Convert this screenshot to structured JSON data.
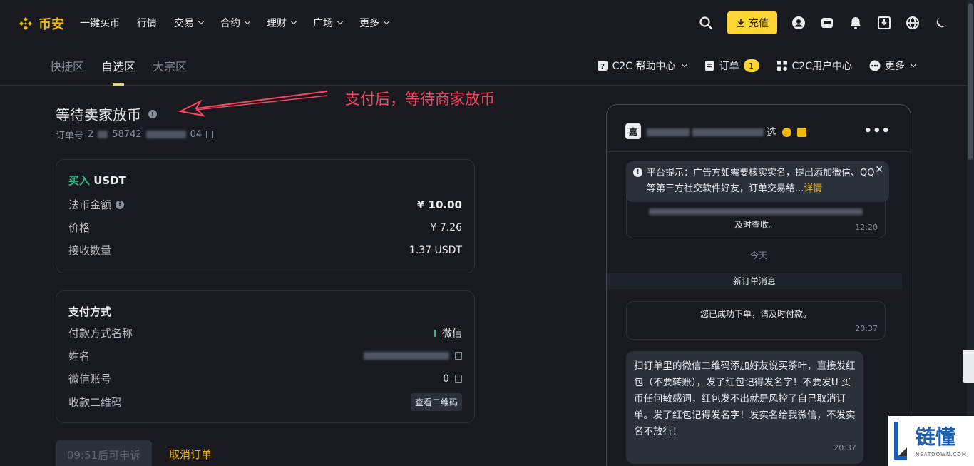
{
  "brand": {
    "name": "币安",
    "color": "#f0b90b"
  },
  "nav": {
    "items": [
      {
        "label": "一键买币",
        "dropdown": false
      },
      {
        "label": "行情",
        "dropdown": false
      },
      {
        "label": "交易",
        "dropdown": true
      },
      {
        "label": "合约",
        "dropdown": true
      },
      {
        "label": "理财",
        "dropdown": true
      },
      {
        "label": "广场",
        "dropdown": true
      },
      {
        "label": "更多",
        "dropdown": true
      }
    ],
    "deposit_label": "充值",
    "icons": [
      "search-icon",
      "user-icon",
      "wallet-icon",
      "bell-icon",
      "download-icon",
      "globe-icon",
      "moon-icon"
    ]
  },
  "subnav": {
    "tabs": [
      {
        "label": "快捷区",
        "active": false
      },
      {
        "label": "自选区",
        "active": true
      },
      {
        "label": "大宗区",
        "active": false
      }
    ],
    "help_center": "C2C 帮助中心",
    "orders": "订单",
    "orders_count": "1",
    "user_center": "C2C用户中心",
    "more": "更多"
  },
  "order": {
    "status_title": "等待卖家放币",
    "order_no_label": "订单号",
    "order_no_visible_start": "2",
    "order_no_visible_mid": "58742",
    "order_no_visible_end": "04"
  },
  "annotation": {
    "text": "支付后，等待商家放币",
    "color": "#f6465d"
  },
  "buy_card": {
    "side": "买入",
    "asset": "USDT",
    "rows": [
      {
        "label": "法币金额",
        "value": "¥ 10.00"
      },
      {
        "label": "价格",
        "value": "¥ 7.26"
      },
      {
        "label": "接收数量",
        "value": "1.37 USDT"
      }
    ]
  },
  "pay_card": {
    "title": "支付方式",
    "method_label": "付款方式名称",
    "method_value": "微信",
    "name_label": "姓名",
    "wechat_label": "微信账号",
    "wechat_value": "0",
    "qr_label": "收款二维码",
    "qr_button": "查看二维码"
  },
  "actions": {
    "appeal": "09:51后可申诉",
    "cancel": "取消订单"
  },
  "chat": {
    "avatar_char": "嘉",
    "name_suffix": "选",
    "tip_prefix": "平台提示：广告方如需要核实实名，提出添加微信、QQ等第三方社交软件好友，订单交易结...",
    "tip_detail": "详情",
    "old_msg_tail": "及时查收。",
    "old_msg_time": "12:20",
    "day_label": "今天",
    "new_order_label": "新订单消息",
    "sys_msg": "您已成功下单，请及时付款。",
    "sys_msg_time": "20:37",
    "merchant_msg": "扫订单里的微信二维码添加好友说买茶叶，直接发红包（不要转账），发了红包记得发名字！不要发U 买币任何敏感词，红包发不出就是风控了自己取消订单。发了红包记得发名字！发实名给我微信，不发实名不放行！",
    "merchant_msg_time": "20:37"
  },
  "watermark": {
    "text": "链懂",
    "sub": "NEATDOWN.COM"
  },
  "colors": {
    "bg": "#181a20",
    "accent": "#fcd535",
    "positive": "#2ebd85",
    "border": "#2b3139",
    "muted": "#848e9c"
  }
}
